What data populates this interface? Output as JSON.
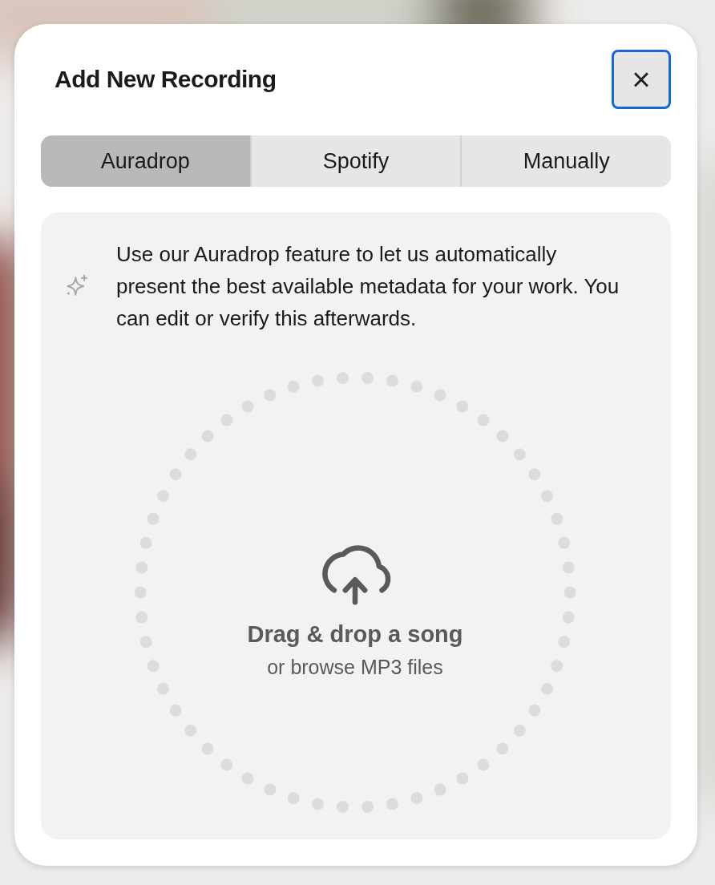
{
  "dialog": {
    "title": "Add New Recording",
    "close_label": "×"
  },
  "tabs": [
    {
      "label": "Auradrop",
      "selected": true
    },
    {
      "label": "Spotify",
      "selected": false
    },
    {
      "label": "Manually",
      "selected": false
    }
  ],
  "panel": {
    "description": "Use our Auradrop feature to let us automatically present the best available metadata for your work. You can edit or verify this afterwards.",
    "dropzone": {
      "title": "Drag & drop a song",
      "subtitle": "or browse MP3 files"
    }
  }
}
